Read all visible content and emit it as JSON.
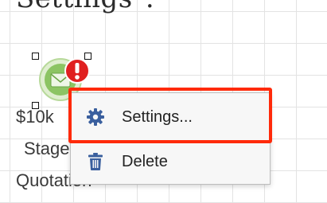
{
  "caption": {
    "text": "Settings\"."
  },
  "node": {
    "icon": "envelope-icon",
    "warning_icon": "exclamation-icon",
    "amount": "$10k",
    "stage_label": "Stage",
    "stage_value": "Quotation",
    "colors": {
      "circle": "#8cc463",
      "warning": "#e02020"
    }
  },
  "context_menu": {
    "items": [
      {
        "label": "Settings...",
        "icon": "gear-icon"
      },
      {
        "label": "Delete",
        "icon": "trash-icon"
      }
    ],
    "colors": {
      "icon": "#3a5f9e",
      "highlight": "#ff2a0a"
    }
  }
}
